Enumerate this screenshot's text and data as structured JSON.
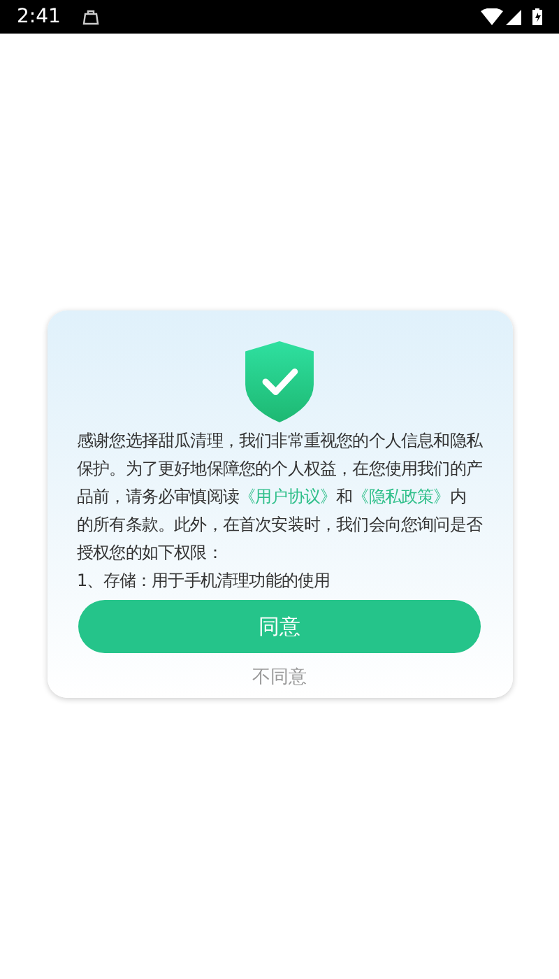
{
  "status_bar": {
    "time": "2:41"
  },
  "dialog": {
    "body": [
      {
        "kind": "text",
        "text": "感谢您选择甜瓜清理，我们非常重视您的个人信息和隐私保护。为了更好地保障您的个人权益，在您使用我们的产品前，请务必审慎阅读"
      },
      {
        "kind": "link",
        "text": "《用户协议》"
      },
      {
        "kind": "text",
        "text": "和"
      },
      {
        "kind": "link",
        "text": "《隐私政策》"
      },
      {
        "kind": "text",
        "text": "内的所有条款。此外，在首次安装时，我们会向您询问是否授权您的如下权限："
      }
    ],
    "list_items": [
      "1、存储：用于手机清理功能的使用"
    ],
    "agree_button": "同意",
    "decline_button": "不同意"
  }
}
